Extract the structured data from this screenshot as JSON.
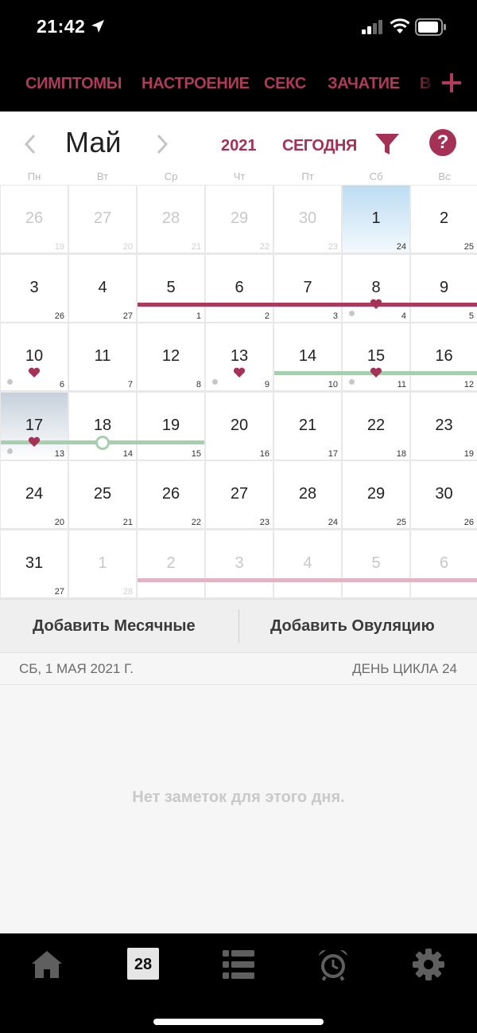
{
  "status_bar": {
    "time": "21:42"
  },
  "top_nav": {
    "tabs": [
      "СИМПТОМЫ",
      "НАСТРОЕНИЕ",
      "СЕКС",
      "ЗАЧАТИЕ",
      "В"
    ],
    "add_icon": "plus-icon"
  },
  "calendar": {
    "month": "Май",
    "year": "2021",
    "today_label": "СЕГОДНЯ",
    "weekdays": [
      "Пн",
      "Вт",
      "Ср",
      "Чт",
      "Пт",
      "Сб",
      "Вс"
    ],
    "weeks": [
      [
        {
          "d": "26",
          "c": "19",
          "dim": true
        },
        {
          "d": "27",
          "c": "20",
          "dim": true
        },
        {
          "d": "28",
          "c": "21",
          "dim": true
        },
        {
          "d": "29",
          "c": "22",
          "dim": true
        },
        {
          "d": "30",
          "c": "23",
          "dim": true
        },
        {
          "d": "1",
          "c": "24",
          "selected": true
        },
        {
          "d": "2",
          "c": "25"
        }
      ],
      [
        {
          "d": "3",
          "c": "26"
        },
        {
          "d": "4",
          "c": "27"
        },
        {
          "d": "5",
          "c": "1"
        },
        {
          "d": "6",
          "c": "2"
        },
        {
          "d": "7",
          "c": "3"
        },
        {
          "d": "8",
          "c": "4",
          "heart": true,
          "dot": true
        },
        {
          "d": "9",
          "c": "5"
        }
      ],
      [
        {
          "d": "10",
          "c": "6",
          "heart": true,
          "dot": true
        },
        {
          "d": "11",
          "c": "7"
        },
        {
          "d": "12",
          "c": "8"
        },
        {
          "d": "13",
          "c": "9",
          "heart": true,
          "dot": true
        },
        {
          "d": "14",
          "c": "10"
        },
        {
          "d": "15",
          "c": "11",
          "heart": true,
          "dot": true
        },
        {
          "d": "16",
          "c": "12"
        }
      ],
      [
        {
          "d": "17",
          "c": "13",
          "heart": true,
          "dot": true,
          "today": true
        },
        {
          "d": "18",
          "c": "14",
          "ovulation": true
        },
        {
          "d": "19",
          "c": "15"
        },
        {
          "d": "20",
          "c": "16"
        },
        {
          "d": "21",
          "c": "17"
        },
        {
          "d": "22",
          "c": "18"
        },
        {
          "d": "23",
          "c": "19"
        }
      ],
      [
        {
          "d": "24",
          "c": "20"
        },
        {
          "d": "25",
          "c": "21"
        },
        {
          "d": "26",
          "c": "22"
        },
        {
          "d": "27",
          "c": "23"
        },
        {
          "d": "28",
          "c": "24"
        },
        {
          "d": "29",
          "c": "25"
        },
        {
          "d": "30",
          "c": "26"
        }
      ],
      [
        {
          "d": "31",
          "c": "27"
        },
        {
          "d": "1",
          "c": "28",
          "dim": true
        },
        {
          "d": "2",
          "c": "",
          "dim": true
        },
        {
          "d": "3",
          "c": "",
          "dim": true
        },
        {
          "d": "4",
          "c": "",
          "dim": true
        },
        {
          "d": "5",
          "c": "",
          "dim": true
        },
        {
          "d": "6",
          "c": "",
          "dim": true
        }
      ]
    ],
    "bands": [
      {
        "type": "period",
        "week": 1,
        "from": 2,
        "to": 6
      },
      {
        "type": "fertile",
        "week": 2,
        "from": 4,
        "to": 6
      },
      {
        "type": "fertile",
        "week": 3,
        "from": 0,
        "to": 2
      },
      {
        "type": "predicted",
        "week": 5,
        "from": 2,
        "to": 6
      }
    ]
  },
  "actions": {
    "add_period": "Добавить Месячные",
    "add_ovulation": "Добавить Овуляцию"
  },
  "day_info": {
    "date": "СБ, 1 МАЯ 2021 Г.",
    "cycle_day": "ДЕНЬ ЦИКЛА 24",
    "empty_notes": "Нет заметок для этого дня."
  },
  "tab_bar": {
    "calendar_day": "28",
    "items": [
      "home-icon",
      "calendar-icon",
      "list-icon",
      "alarm-clock-icon",
      "gear-icon"
    ]
  },
  "colors": {
    "accent": "#a63157",
    "period": "#ad3a5d",
    "fertile": "#a6cfae",
    "predicted": "#e2b3c2",
    "selected_day": "#bcdcf2"
  }
}
